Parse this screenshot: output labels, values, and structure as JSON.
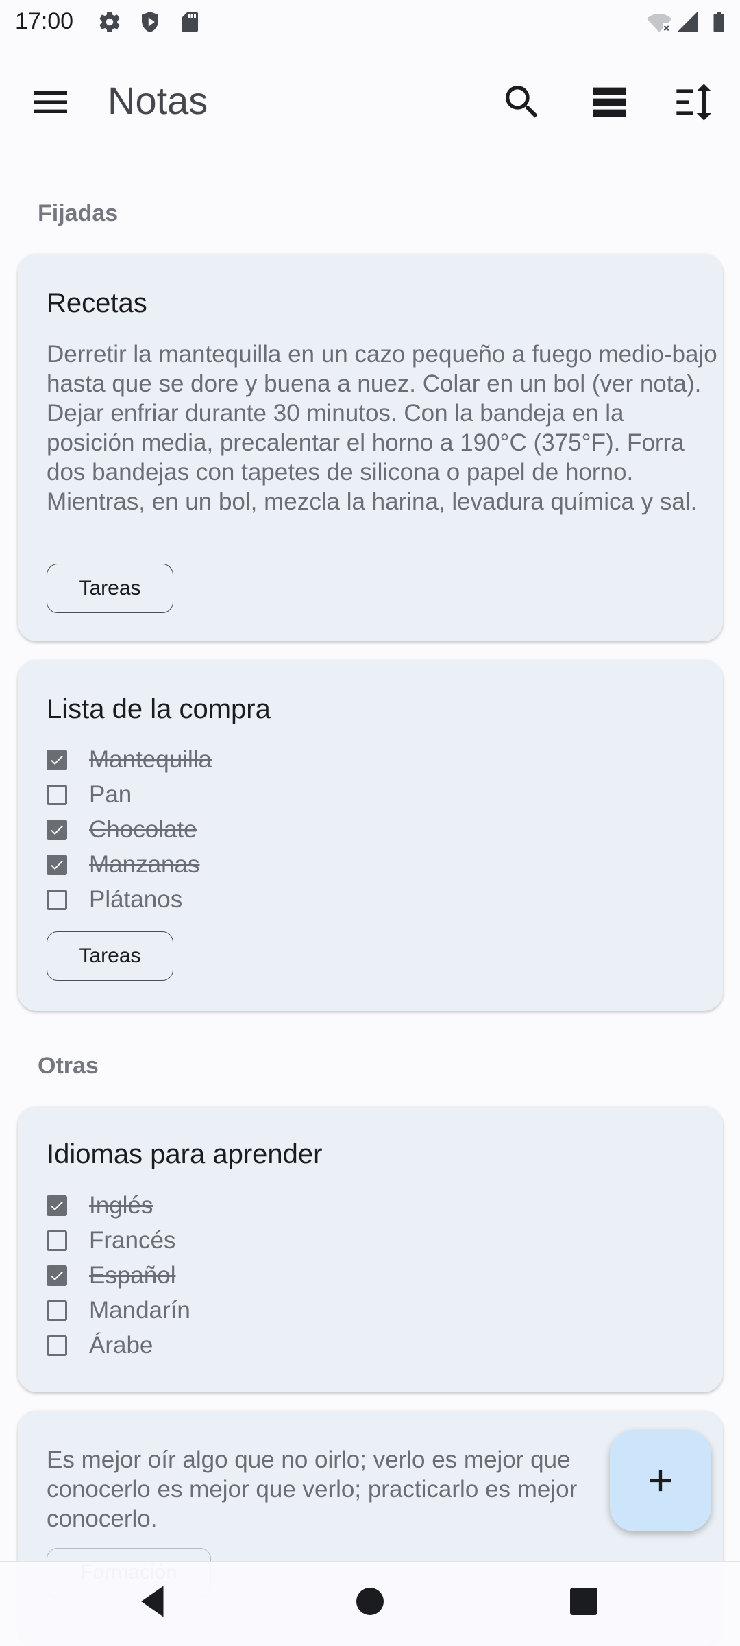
{
  "status_bar": {
    "time": "17:00",
    "left_icons": [
      "settings-icon",
      "shield-icon",
      "sd-card-icon"
    ],
    "right_icons": [
      "wifi-off-icon",
      "signal-icon",
      "battery-icon"
    ]
  },
  "app_bar": {
    "title": "Notas",
    "icons": [
      "menu-icon",
      "search-icon",
      "view-list-icon",
      "sort-icon"
    ]
  },
  "sections": {
    "pinned_label": "Fijadas",
    "others_label": "Otras"
  },
  "notes": {
    "recipes": {
      "title": "Recetas",
      "body": "Derretir la mantequilla en un cazo pequeño a fuego medio-bajo hasta que se dore y buena a nuez. Colar en un bol (ver nota). Dejar enfriar durante 30 minutos. Con la bandeja en la posición media, precalentar el horno a 190°C (375°F). Forra dos bandejas con tapetes de silicona o papel de horno. Mientras, en un bol, mezcla la harina, levadura química y sal.",
      "label": "Tareas"
    },
    "shopping": {
      "title": "Lista de la compra",
      "items": [
        {
          "text": "Mantequilla",
          "checked": true
        },
        {
          "text": "Pan",
          "checked": false
        },
        {
          "text": "Chocolate",
          "checked": true
        },
        {
          "text": "Manzanas",
          "checked": true
        },
        {
          "text": "Plátanos",
          "checked": false
        }
      ],
      "label": "Tareas"
    },
    "languages": {
      "title": "Idiomas para aprender",
      "items": [
        {
          "text": "Inglés",
          "checked": true
        },
        {
          "text": "Francés",
          "checked": false
        },
        {
          "text": "Español",
          "checked": true
        },
        {
          "text": "Mandarín",
          "checked": false
        },
        {
          "text": "Árabe",
          "checked": false
        }
      ]
    },
    "quote": {
      "body": "Es mejor oír algo que no oirlo; verlo es mejor que conocerlo es mejor que verlo; practicarlo es mejor conocerlo.",
      "label": "Formación"
    }
  },
  "fab": {
    "icon": "plus-icon"
  },
  "nav_bar": {
    "icons": [
      "back-icon",
      "home-icon",
      "recents-icon"
    ]
  },
  "colors": {
    "card_bg": "#eaf0f6",
    "fab_bg": "#cde5fb",
    "page_bg": "#fbfbfe"
  }
}
